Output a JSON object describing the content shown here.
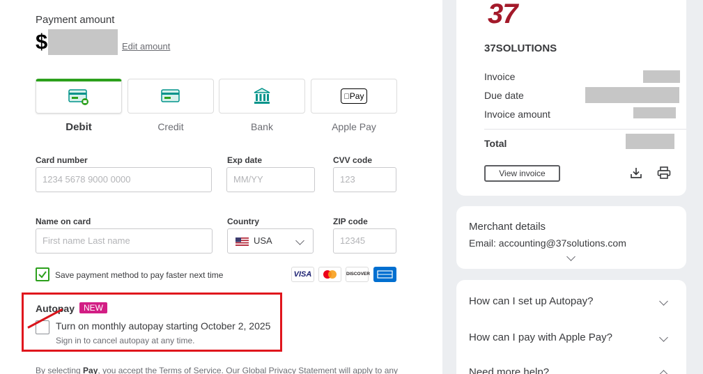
{
  "payment": {
    "label": "Payment amount",
    "currency_symbol": "$",
    "edit_label": "Edit amount"
  },
  "methods": [
    {
      "label": "Debit",
      "icon": "debit-card-icon",
      "selected": true
    },
    {
      "label": "Credit",
      "icon": "credit-card-icon",
      "selected": false
    },
    {
      "label": "Bank",
      "icon": "bank-icon",
      "selected": false
    },
    {
      "label": "Apple Pay",
      "icon": "apple-pay-icon",
      "selected": false
    }
  ],
  "apple_pay_mark": "Pay",
  "form": {
    "card_number": {
      "label": "Card number",
      "placeholder": "1234 5678 9000 0000"
    },
    "exp_date": {
      "label": "Exp date",
      "placeholder": "MM/YY"
    },
    "cvv": {
      "label": "CVV code",
      "placeholder": "123"
    },
    "name": {
      "label": "Name on card",
      "placeholder": "First name Last name"
    },
    "country": {
      "label": "Country",
      "value": "USA"
    },
    "zip": {
      "label": "ZIP code",
      "placeholder": "12345"
    }
  },
  "save_method": {
    "label": "Save payment method to pay faster next time",
    "checked": true
  },
  "card_brands": [
    "VISA",
    "Mastercard",
    "DISCOVER",
    "AMEX"
  ],
  "autopay": {
    "title": "Autopay",
    "badge": "NEW",
    "checkbox_label": "Turn on monthly autopay starting October 2, 2025",
    "sub": "Sign in to cancel autopay at any time.",
    "checked": false
  },
  "legal": {
    "prefix": "By selecting ",
    "pay_word": "Pay",
    "suffix": ", you accept the Terms of Service. Our Global Privacy Statement will apply to any"
  },
  "invoice": {
    "logo_text": "37",
    "company": "37SOLUTIONS",
    "rows": [
      {
        "label": "Invoice"
      },
      {
        "label": "Due date"
      },
      {
        "label": "Invoice amount"
      }
    ],
    "total_label": "Total",
    "view_button": "View invoice"
  },
  "merchant": {
    "title": "Merchant details",
    "email": "Email: accounting@37solutions.com"
  },
  "faq": [
    {
      "question": "How can I set up Autopay?"
    },
    {
      "question": "How can I pay with Apple Pay?"
    },
    {
      "question": "Need more help?"
    }
  ],
  "colors": {
    "accent_green": "#2ca01c",
    "brand_red": "#a3192a",
    "highlight_red": "#e0161d",
    "badge_pink": "#d21e84"
  }
}
